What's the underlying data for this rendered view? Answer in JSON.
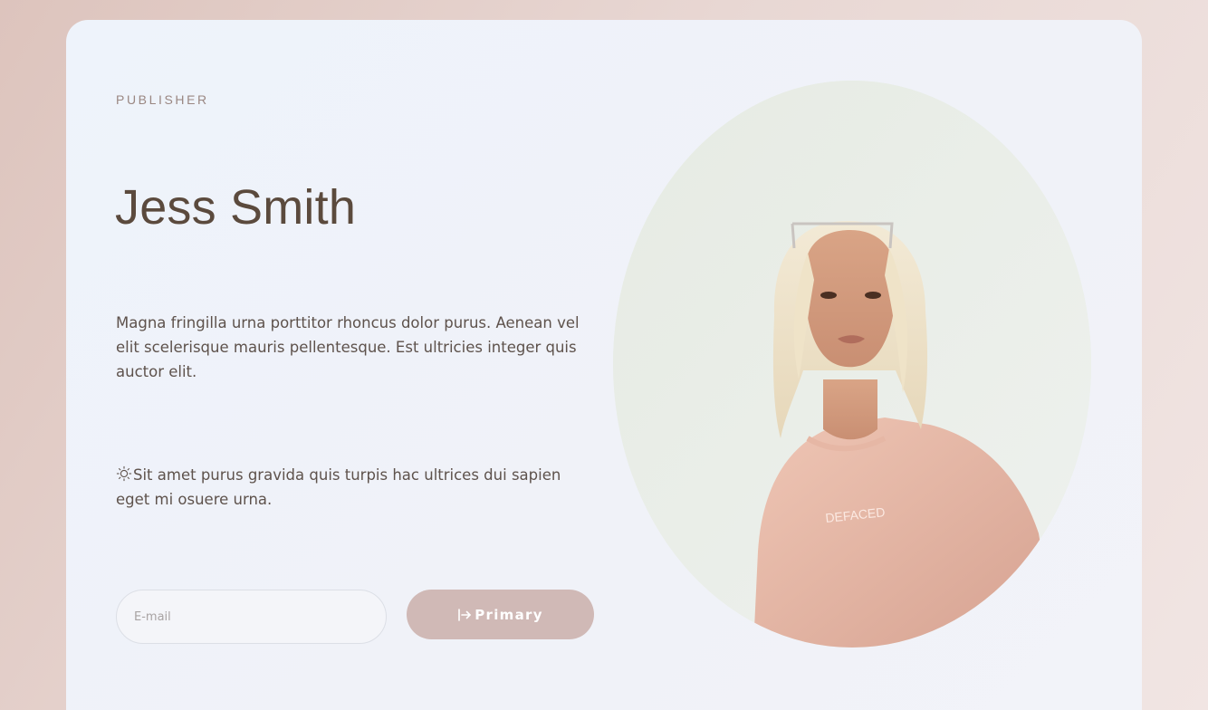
{
  "eyebrow": "PUBLISHER",
  "name": "Jess Smith",
  "paragraph_1": "Magna fringilla urna porttitor rhoncus dolor purus. Aenean vel elit scelerisque mauris pellentesque. Est ultricies integer quis auctor elit.",
  "paragraph_2": "Sit amet purus gravida quis turpis hac ultrices dui sapien eget mi osuere urna.",
  "paragraph_2_icon": "sun-icon",
  "form": {
    "email_placeholder": "E-mail",
    "email_value": "",
    "submit_label": "Primary",
    "submit_icon": "sign-in-arrow-icon"
  },
  "colors": {
    "title": "#5b4a3d",
    "eyebrow": "#9a8782",
    "body_text": "#5e524c",
    "button_bg": "#d0b9b6",
    "card_bg": "#eef3fb",
    "page_bg": "#e3cec9"
  }
}
